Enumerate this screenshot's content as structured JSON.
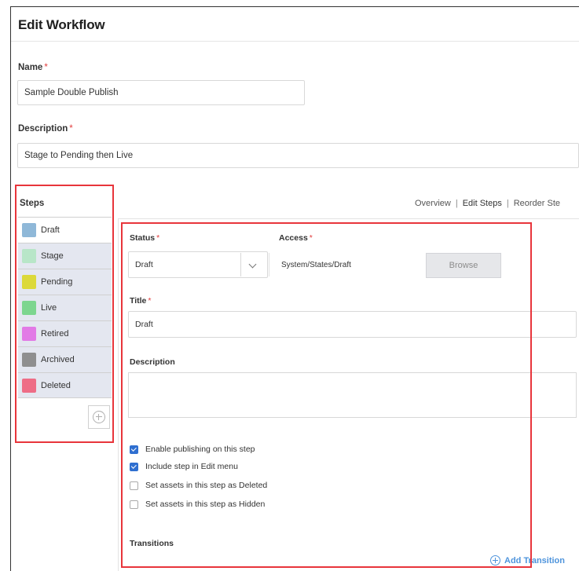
{
  "page": {
    "title": "Edit Workflow"
  },
  "name_field": {
    "label": "Name",
    "required": "*",
    "value": "Sample Double Publish"
  },
  "description_field": {
    "label": "Description",
    "required": "*",
    "value": "Stage to Pending then Live"
  },
  "steps": {
    "title": "Steps",
    "items": [
      {
        "label": "Draft",
        "color": "#8fb8d8"
      },
      {
        "label": "Stage",
        "color": "#b8e6c8"
      },
      {
        "label": "Pending",
        "color": "#dcd93a"
      },
      {
        "label": "Live",
        "color": "#7dd68f"
      },
      {
        "label": "Retired",
        "color": "#e27ae6"
      },
      {
        "label": "Archived",
        "color": "#8f8f8f"
      },
      {
        "label": "Deleted",
        "color": "#ee6d86"
      }
    ]
  },
  "nav": {
    "overview": "Overview",
    "edit_steps": "Edit Steps",
    "reorder": "Reorder Ste"
  },
  "step_detail": {
    "status_label": "Status",
    "status_value": "Draft",
    "access_label": "Access",
    "access_value": "System/States/Draft",
    "browse_label": "Browse",
    "title_label": "Title",
    "title_value": "Draft",
    "description_label": "Description",
    "required": "*",
    "checkboxes": [
      {
        "label": "Enable publishing on this step",
        "checked": true
      },
      {
        "label": "Include step in Edit menu",
        "checked": true
      },
      {
        "label": "Set assets in this step as Deleted",
        "checked": false
      },
      {
        "label": "Set assets in this step as Hidden",
        "checked": false
      }
    ],
    "transitions_label": "Transitions",
    "add_transition_label": "Add Transition"
  },
  "colors": {
    "highlight": "#e8353b",
    "accent": "#4e94dc",
    "checkbox": "#2f6fd0"
  }
}
